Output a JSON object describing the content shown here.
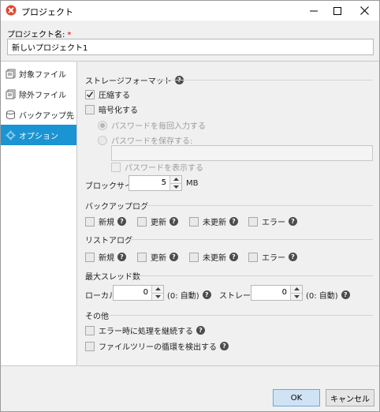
{
  "window": {
    "title": "プロジェクト",
    "accent_color": "#1a94d3",
    "app_icon": "app-logo-icon",
    "controls": [
      "minimize-icon",
      "maximize-icon",
      "close-icon"
    ]
  },
  "project": {
    "name_label": "プロジェクト名:",
    "required_mark": "*",
    "name_value": "新しいプロジェクト1"
  },
  "sidebar": {
    "items": [
      {
        "label": "対象ファイル",
        "icon": "file-list-icon",
        "active": false
      },
      {
        "label": "除外ファイル",
        "icon": "file-exclude-icon",
        "active": false
      },
      {
        "label": "バックアップ先",
        "icon": "disk-icon",
        "active": false
      },
      {
        "label": "オプション",
        "icon": "gear-icon",
        "active": true
      }
    ]
  },
  "options": {
    "storage_format": {
      "title": "ストレージフォーマット",
      "compress_label": "圧縮する",
      "compress_checked": true,
      "encrypt_label": "暗号化する",
      "encrypt_checked": false,
      "password_each_label": "パスワードを毎回入力する",
      "password_save_label": "パスワードを保存する:",
      "show_password_label": "パスワードを表示する"
    },
    "block_size": {
      "label": "ブロックサイズ:",
      "value": "5",
      "unit": "MB"
    },
    "backup_log": {
      "title": "バックアップログ",
      "items": [
        "新規",
        "更新",
        "未更新",
        "エラー"
      ]
    },
    "restore_log": {
      "title": "リストアログ",
      "items": [
        "新規",
        "更新",
        "未更新",
        "エラー"
      ]
    },
    "threads": {
      "title": "最大スレッド数",
      "local_label": "ローカル:",
      "local_value": "0",
      "local_hint": "(0: 自動)",
      "storage_label": "ストレージ:",
      "storage_value": "0",
      "storage_hint": "(0: 自動)"
    },
    "other": {
      "title": "その他",
      "continue_on_error_label": "エラー時に処理を継続する",
      "detect_loop_label": "ファイルツリーの循環を検出する"
    }
  },
  "footer": {
    "ok_label": "OK",
    "cancel_label": "キャンセル"
  }
}
